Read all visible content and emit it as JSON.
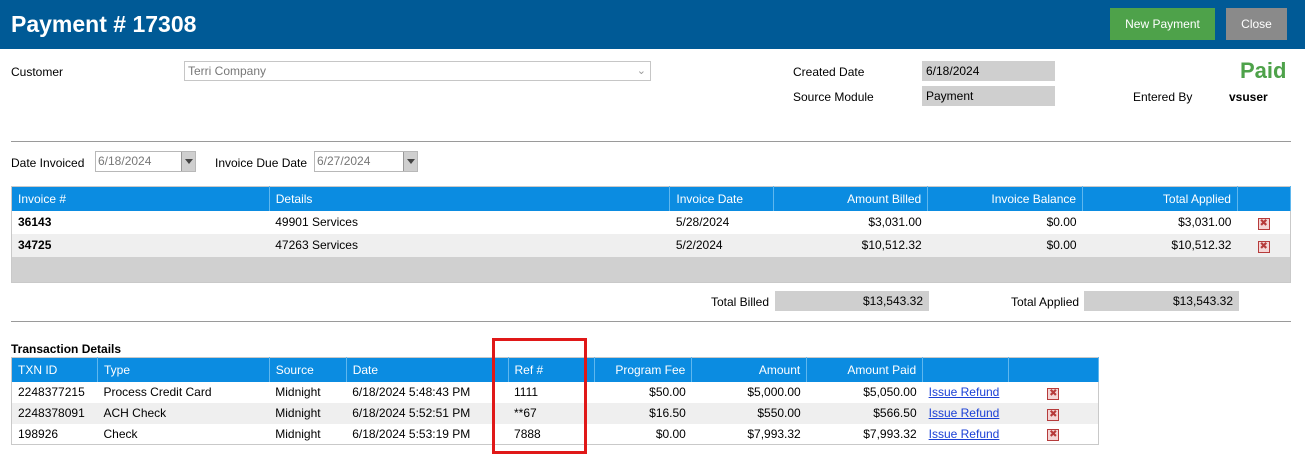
{
  "header": {
    "title": "Payment # 17308",
    "new_payment_label": "New Payment",
    "close_label": "Close",
    "status": "Paid"
  },
  "form": {
    "customer_label": "Customer",
    "customer_value": "Terri Company",
    "created_date_label": "Created Date",
    "created_date_value": "6/18/2024",
    "source_module_label": "Source Module",
    "source_module_value": "Payment",
    "entered_by_label": "Entered By",
    "entered_by_value": "vsuser",
    "date_invoiced_label": "Date Invoiced",
    "date_invoiced_value": "6/18/2024",
    "invoice_due_date_label": "Invoice Due Date",
    "invoice_due_date_value": "6/27/2024"
  },
  "invoices": {
    "columns": [
      "Invoice #",
      "Details",
      "Invoice Date",
      "Amount Billed",
      "Invoice Balance",
      "Total Applied"
    ],
    "rows": [
      {
        "invoice": "36143",
        "details": "49901 Services",
        "date": "5/28/2024",
        "billed": "$3,031.00",
        "balance": "$0.00",
        "applied": "$3,031.00"
      },
      {
        "invoice": "34725",
        "details": "47263 Services",
        "date": "5/2/2024",
        "billed": "$10,512.32",
        "balance": "$0.00",
        "applied": "$10,512.32"
      }
    ],
    "total_billed_label": "Total Billed",
    "total_billed_value": "$13,543.32",
    "total_applied_label": "Total Applied",
    "total_applied_value": "$13,543.32"
  },
  "transactions": {
    "section_title": "Transaction Details",
    "columns": [
      "TXN ID",
      "Type",
      "Source",
      "Date",
      "Ref #",
      "Program Fee",
      "Amount",
      "Amount Paid"
    ],
    "refund_label": "Issue Refund",
    "rows": [
      {
        "txn": "2248377215",
        "type": "Process Credit Card",
        "source": "Midnight",
        "date": "6/18/2024 5:48:43 PM",
        "ref": "1111",
        "fee": "$50.00",
        "amount": "$5,000.00",
        "paid": "$5,050.00"
      },
      {
        "txn": "2248378091",
        "type": "ACH Check",
        "source": "Midnight",
        "date": "6/18/2024 5:52:51 PM",
        "ref": "**67",
        "fee": "$16.50",
        "amount": "$550.00",
        "paid": "$566.50"
      },
      {
        "txn": "198926",
        "type": "Check",
        "source": "Midnight",
        "date": "6/18/2024 5:53:19 PM",
        "ref": "7888",
        "fee": "$0.00",
        "amount": "$7,993.32",
        "paid": "$7,993.32"
      }
    ]
  },
  "colors": {
    "header_bg": "#005a96",
    "table_header_bg": "#0b8ce1",
    "new_button": "#4ea24a",
    "close_button": "#8a8a8a",
    "paid_status": "#4ea24a",
    "highlight_box": "#e01818"
  },
  "icons": {
    "delete": "delete-x-icon",
    "dropdown": "chevron-down-icon",
    "calendar": "date-dropdown-icon"
  }
}
